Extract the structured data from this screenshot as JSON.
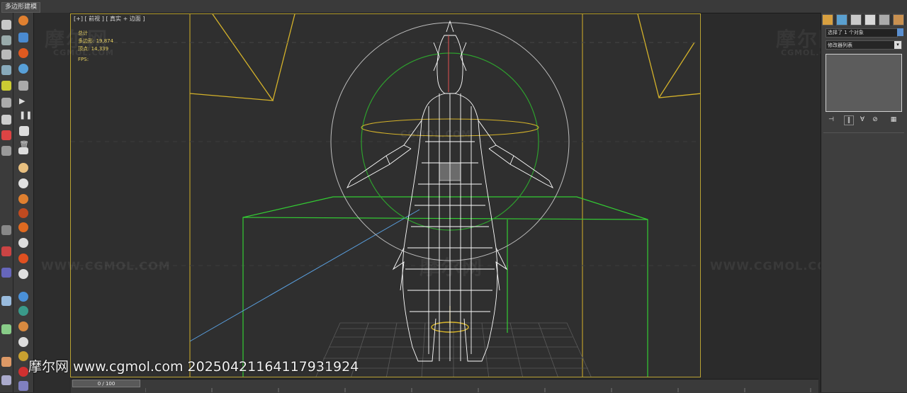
{
  "ribbon": {
    "tab_label": "多边形建模"
  },
  "viewport": {
    "label": "[+] [ 前视 ] [ 真实 + 边面 ]",
    "stats": {
      "total_label": "总计",
      "polys": "多边形: 19,874",
      "verts": "顶点: 14,339",
      "fps": "FPS:"
    }
  },
  "command_panel": {
    "object_name": "选择了 1 个对象",
    "modifier_list": "修改器列表",
    "dropdown_icon": "chevron-down-icon"
  },
  "timeline": {
    "slider_label": "0 / 100"
  },
  "watermarks": {
    "logo_text": "摩尔网",
    "logo_sub": "CGMOL.COM",
    "url_text": "WWW.CGMOL.COM",
    "footer": "摩尔网 www.cgmol.com 20250421164117931924"
  },
  "colors": {
    "viewport_border": "#b9a233",
    "wireframe": "#ffffff",
    "bbox_green": "#33cc33",
    "camera_yellow": "#d4b22a",
    "light_blue": "#5aa0e0"
  }
}
